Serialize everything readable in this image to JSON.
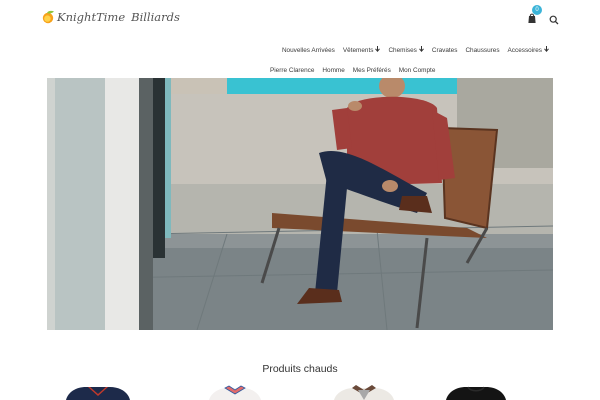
{
  "brand": {
    "name_part1": "KnightTime",
    "name_part2": "Billiards"
  },
  "cart": {
    "count": "0",
    "icon": "cart-icon"
  },
  "search": {
    "icon": "search-icon"
  },
  "nav": {
    "row1": [
      {
        "label": "Nouvelles Arrivées",
        "has_dropdown": false
      },
      {
        "label": "Vêtements",
        "has_dropdown": true
      },
      {
        "label": "Chemises",
        "has_dropdown": true
      },
      {
        "label": "Cravates",
        "has_dropdown": false
      },
      {
        "label": "Chaussures",
        "has_dropdown": false
      },
      {
        "label": "Accessoires",
        "has_dropdown": true
      }
    ],
    "row2": [
      {
        "label": "Pierre Clarence"
      },
      {
        "label": "Homme"
      },
      {
        "label": "Mes Préférés"
      },
      {
        "label": "Mon Compte"
      }
    ]
  },
  "hero": {
    "image": "hero-photo-man-seated-in-woven-chair"
  },
  "featured": {
    "title": "Produits chauds"
  },
  "colors": {
    "accent": "#3bb4d8",
    "nav_text": "#3a3a3a",
    "logo_green": "#8cc63f",
    "logo_orange": "#f7a21b"
  }
}
